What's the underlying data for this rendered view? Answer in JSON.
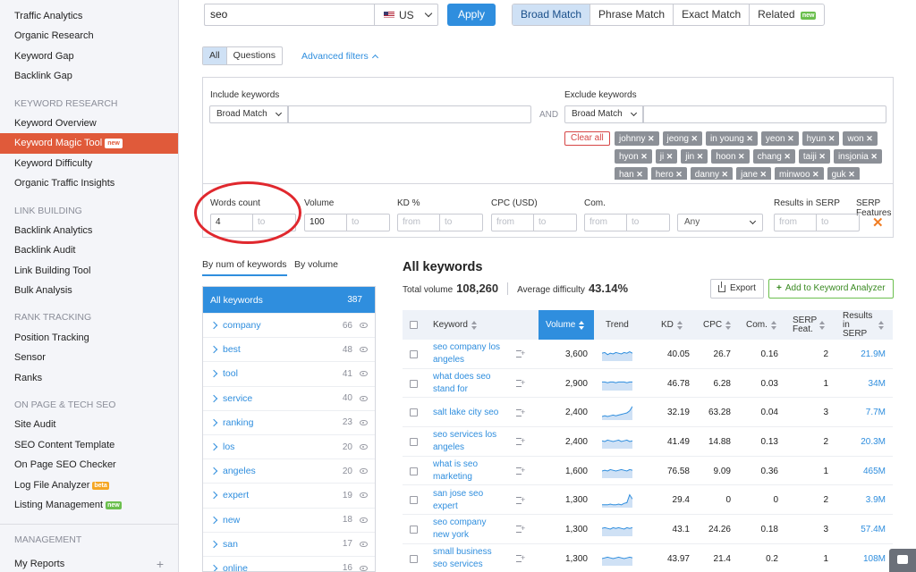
{
  "sidebar": {
    "top_items": [
      "Traffic Analytics",
      "Organic Research",
      "Keyword Gap",
      "Backlink Gap"
    ],
    "sections": [
      {
        "title": "KEYWORD RESEARCH",
        "items": [
          {
            "label": "Keyword Overview"
          },
          {
            "label": "Keyword Magic Tool",
            "badge": "new",
            "active": true
          },
          {
            "label": "Keyword Difficulty"
          },
          {
            "label": "Organic Traffic Insights"
          }
        ]
      },
      {
        "title": "LINK BUILDING",
        "items": [
          {
            "label": "Backlink Analytics"
          },
          {
            "label": "Backlink Audit"
          },
          {
            "label": "Link Building Tool"
          },
          {
            "label": "Bulk Analysis"
          }
        ]
      },
      {
        "title": "RANK TRACKING",
        "items": [
          {
            "label": "Position Tracking"
          },
          {
            "label": "Sensor"
          },
          {
            "label": "Ranks"
          }
        ]
      },
      {
        "title": "ON PAGE & TECH SEO",
        "items": [
          {
            "label": "Site Audit"
          },
          {
            "label": "SEO Content Template"
          },
          {
            "label": "On Page SEO Checker"
          },
          {
            "label": "Log File Analyzer",
            "badge": "beta"
          },
          {
            "label": "Listing Management",
            "badge": "new"
          }
        ]
      }
    ],
    "management": {
      "title": "MANAGEMENT",
      "items": [
        "My Reports"
      ],
      "plus": "+"
    }
  },
  "search": {
    "value": "seo",
    "database": "US",
    "apply_label": "Apply"
  },
  "match_tabs": [
    {
      "label": "Broad Match",
      "active": true
    },
    {
      "label": "Phrase Match"
    },
    {
      "label": "Exact Match"
    },
    {
      "label": "Related",
      "badge": "new"
    }
  ],
  "aq_tabs": [
    {
      "label": "All",
      "active": true
    },
    {
      "label": "Questions"
    }
  ],
  "advanced_filters_label": "Advanced filters",
  "filters": {
    "include_label": "Include keywords",
    "include_match": "Broad Match",
    "exclude_label": "Exclude keywords",
    "exclude_match": "Broad Match",
    "and_label": "AND",
    "clear_all": "Clear all",
    "exclude_tags": [
      "johnny",
      "jeong",
      "in young",
      "yeon",
      "hyun",
      "won",
      "hyon",
      "ji",
      "jin",
      "hoon",
      "chang",
      "taiji",
      "insjonia",
      "han",
      "hero",
      "danny",
      "jane",
      "minwoo",
      "guk"
    ],
    "ranges": [
      {
        "label": "Words count",
        "from": "4",
        "to": "to"
      },
      {
        "label": "Volume",
        "from": "100",
        "to": "to"
      },
      {
        "label": "KD %",
        "from": "from",
        "to": "to"
      },
      {
        "label": "CPC (USD)",
        "from": "from",
        "to": "to"
      },
      {
        "label": "Com.",
        "from": "from",
        "to": "to"
      }
    ],
    "serp_label": "SERP Features",
    "serp_value": "Any",
    "results_label": "Results in SERP",
    "results_from": "from",
    "results_to": "to",
    "clear_icon": "✕"
  },
  "group_tabs": [
    "By num of keywords",
    "By volume"
  ],
  "groups": [
    {
      "name": "All keywords",
      "count": "387",
      "active": true
    },
    {
      "name": "company",
      "count": "66"
    },
    {
      "name": "best",
      "count": "48"
    },
    {
      "name": "tool",
      "count": "41"
    },
    {
      "name": "service",
      "count": "40"
    },
    {
      "name": "ranking",
      "count": "23"
    },
    {
      "name": "los",
      "count": "20"
    },
    {
      "name": "angeles",
      "count": "20"
    },
    {
      "name": "expert",
      "count": "19"
    },
    {
      "name": "new",
      "count": "18"
    },
    {
      "name": "san",
      "count": "17"
    },
    {
      "name": "online",
      "count": "16"
    }
  ],
  "results": {
    "title": "All keywords",
    "total_volume_label": "Total volume",
    "total_volume": "108,260",
    "avg_difficulty_label": "Average difficulty",
    "avg_difficulty": "43.14%",
    "export_label": "Export",
    "add_analyzer_label": "Add to Keyword Analyzer"
  },
  "table": {
    "headers": {
      "keyword": "Keyword",
      "volume": "Volume",
      "trend": "Trend",
      "kd": "KD",
      "cpc": "CPC",
      "com": "Com.",
      "serp": "SERP Feat.",
      "results": "Results in SERP"
    },
    "rows": [
      {
        "keyword": "seo company los angeles",
        "volume": "3,600",
        "kd": "40.05",
        "cpc": "26.7",
        "com": "0.16",
        "serp": "2",
        "results": "21.9M",
        "trend": [
          0.55,
          0.6,
          0.45,
          0.55,
          0.5,
          0.6,
          0.55,
          0.5,
          0.6,
          0.55,
          0.65,
          0.55
        ]
      },
      {
        "keyword": "what does seo stand for",
        "volume": "2,900",
        "kd": "46.78",
        "cpc": "6.28",
        "com": "0.03",
        "serp": "1",
        "results": "34M",
        "trend": [
          0.6,
          0.6,
          0.55,
          0.6,
          0.6,
          0.55,
          0.6,
          0.6,
          0.6,
          0.55,
          0.6,
          0.6
        ]
      },
      {
        "keyword": "salt lake city seo",
        "volume": "2,400",
        "kd": "32.19",
        "cpc": "63.28",
        "com": "0.04",
        "serp": "3",
        "results": "7.7M",
        "trend": [
          0.25,
          0.3,
          0.25,
          0.3,
          0.35,
          0.3,
          0.35,
          0.4,
          0.45,
          0.5,
          0.65,
          0.95
        ]
      },
      {
        "keyword": "seo services los angeles",
        "volume": "2,400",
        "kd": "41.49",
        "cpc": "14.88",
        "com": "0.13",
        "serp": "2",
        "results": "20.3M",
        "trend": [
          0.55,
          0.5,
          0.6,
          0.55,
          0.5,
          0.55,
          0.6,
          0.5,
          0.55,
          0.6,
          0.5,
          0.55
        ]
      },
      {
        "keyword": "what is seo marketing",
        "volume": "1,600",
        "kd": "76.58",
        "cpc": "9.09",
        "com": "0.36",
        "serp": "1",
        "results": "465M",
        "trend": [
          0.5,
          0.55,
          0.5,
          0.6,
          0.55,
          0.5,
          0.55,
          0.6,
          0.55,
          0.5,
          0.6,
          0.55
        ]
      },
      {
        "keyword": "san jose seo expert",
        "volume": "1,300",
        "kd": "29.4",
        "cpc": "0",
        "com": "0",
        "serp": "2",
        "results": "3.9M",
        "trend": [
          0.2,
          0.2,
          0.2,
          0.25,
          0.2,
          0.2,
          0.25,
          0.2,
          0.3,
          0.35,
          0.9,
          0.6
        ]
      },
      {
        "keyword": "seo company new york",
        "volume": "1,300",
        "kd": "43.1",
        "cpc": "24.26",
        "com": "0.18",
        "serp": "3",
        "results": "57.4M",
        "trend": [
          0.55,
          0.6,
          0.55,
          0.5,
          0.6,
          0.55,
          0.6,
          0.55,
          0.5,
          0.6,
          0.55,
          0.6
        ]
      },
      {
        "keyword": "small business seo services",
        "volume": "1,300",
        "kd": "43.97",
        "cpc": "21.4",
        "com": "0.2",
        "serp": "1",
        "results": "108M",
        "trend": [
          0.5,
          0.55,
          0.6,
          0.55,
          0.5,
          0.55,
          0.6,
          0.55,
          0.5,
          0.55,
          0.6,
          0.55
        ]
      }
    ]
  },
  "colors": {
    "accent": "#2f8ede",
    "active_nav": "#e05a3a",
    "highlight_ring": "#e0282e"
  }
}
